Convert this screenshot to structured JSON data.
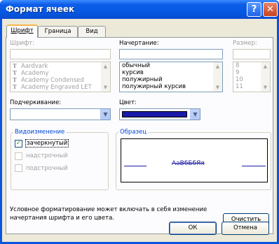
{
  "window": {
    "title": "Формат ячеек",
    "help_glyph": "?",
    "close_glyph": "✕"
  },
  "tabs": [
    {
      "label": "Шрифт",
      "active": true
    },
    {
      "label": "Граница",
      "active": false
    },
    {
      "label": "Вид",
      "active": false
    }
  ],
  "font": {
    "label": "Шрифт:",
    "value": "",
    "items": [
      "Aardvark",
      "Academy",
      "Academy Condensed",
      "Academy Engraved LET"
    ]
  },
  "style": {
    "label": "Начертание:",
    "value": "",
    "items": [
      "обычный",
      "курсив",
      "полужирный",
      "полужирный курсив"
    ]
  },
  "size": {
    "label": "Размер:",
    "value": "",
    "items": [
      "8",
      "9",
      "10",
      "11"
    ]
  },
  "underline": {
    "label": "Подчеркивание:",
    "value": ""
  },
  "color": {
    "label": "Цвет:",
    "value_color": "#1a1aa8"
  },
  "effects": {
    "title": "Видоизменение",
    "strikethrough": {
      "label": "зачеркнутый",
      "checked": true
    },
    "superscript": {
      "label": "надстрочный",
      "checked": false
    },
    "subscript": {
      "label": "подстрочный",
      "checked": false
    }
  },
  "preview": {
    "title": "Образец",
    "text": "АаВбБбЯя"
  },
  "info_text_line1": "Условное форматирование может включать в себя изменение",
  "info_text_line2": "начертания шрифта и его цвета.",
  "buttons": {
    "clear": "Очистить",
    "ok": "ОК",
    "cancel": "Отмена"
  },
  "icons": {
    "help": "help-icon",
    "close": "close-icon",
    "font": "truetype-icon",
    "checkmark": "checkmark-icon"
  }
}
